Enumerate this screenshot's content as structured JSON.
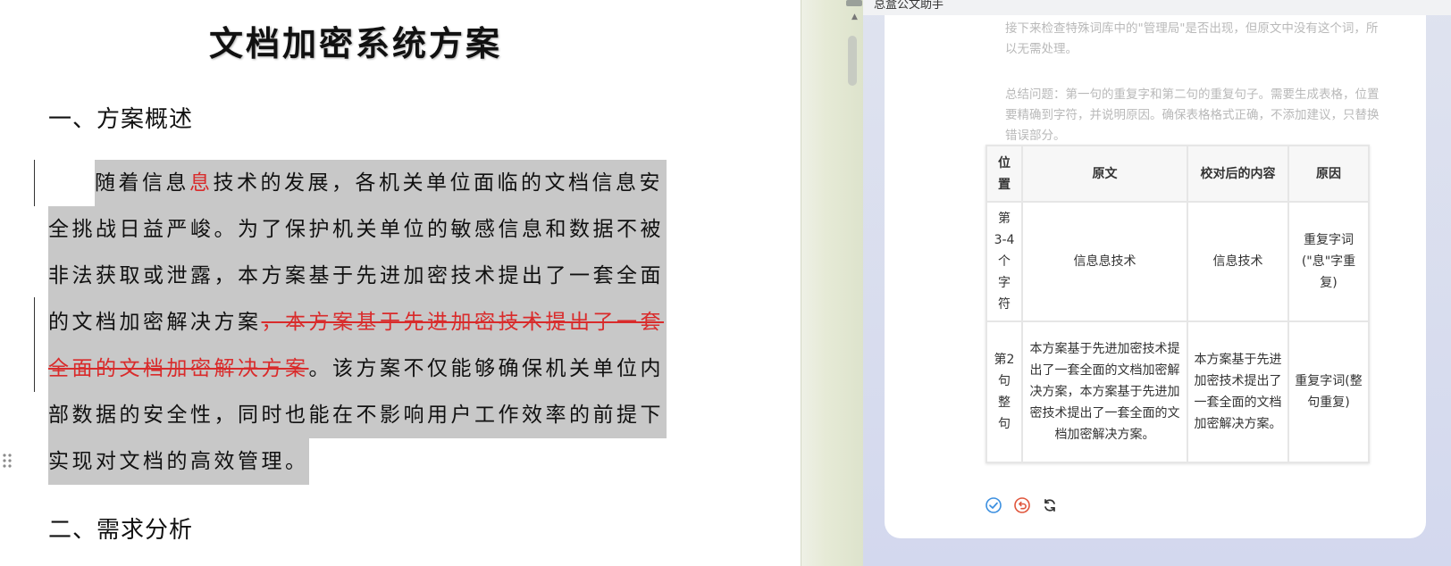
{
  "document": {
    "title": "文档加密系统方案",
    "heading1": "一、方案概述",
    "heading2": "二、需求分析",
    "paragraph": {
      "line1_a": "随着信息",
      "line1_red": "息",
      "line1_b": "技术的发展，各机关单位面临的文档信息安",
      "line2": "全挑战日益严峻。为了保护机关单位的敏感信息和数据不被",
      "line3": "非法获取或泄露，本方案基于先进加密技术提出了一套全面",
      "line4_a": "的文档加密解决方案",
      "line4_del": "，本方案基于先进加密技术提出了一套",
      "line5_del": "全面的文档加密解决方案",
      "line5_b": "。该方案不仅能够确保机关单位内",
      "line6": "部数据的安全性，同时也能在不影响用户工作效率的前提下",
      "line7": "实现对文档的高效管理。"
    }
  },
  "assistant": {
    "title": "总盒公文助手",
    "faded_text_1": "接下来检查特殊词库中的\"管理局\"是否出现，但原文中没有这个词，所以无需处理。",
    "faded_text_2": "总结问题：第一句的重复字和第二句的重复句子。需要生成表格，位置要精确到字符，并说明原因。确保表格格式正确，不添加建议，只替换错误部分。",
    "table": {
      "headers": [
        "位置",
        "原文",
        "校对后的内容",
        "原因"
      ],
      "rows": [
        {
          "position": "第3-4个字符",
          "original": "信息息技术",
          "corrected": "信息技术",
          "reason": "重复字词(\"息\"字重复)"
        },
        {
          "position": "第2句整句",
          "original": "本方案基于先进加密技术提出了一套全面的文档加密解决方案，本方案基于先进加密技术提出了一套全面的文档加密解决方案。",
          "corrected": "本方案基于先进加密技术提出了一套全面的文档加密解决方案。",
          "reason": "重复字词(整句重复)"
        }
      ]
    },
    "actions": {
      "accept_icon": "check-circle-icon",
      "reject_icon": "undo-circle-icon",
      "refresh_icon": "refresh-icon",
      "accept_color": "#3b8fe0",
      "reject_color": "#e0553b"
    }
  }
}
